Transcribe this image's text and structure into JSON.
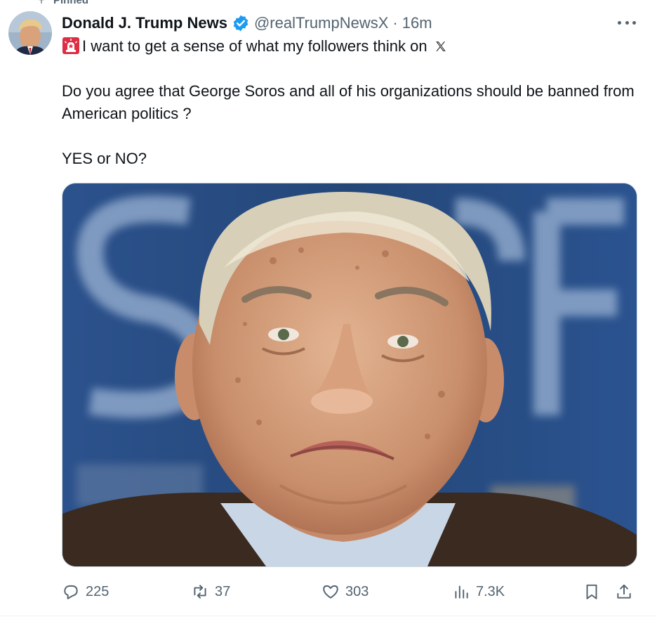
{
  "pinned_label": "Pinned",
  "author": {
    "name": "Donald J. Trump News",
    "handle": "@realTrumpNewsX",
    "separator": "·",
    "time": "16m",
    "verified": true,
    "avatar_icon": "avatar-photo"
  },
  "tweet": {
    "line1": "I want to get a sense of what my followers think on",
    "line1_emoji": "rotating-light-emoji",
    "line1_logo": "x-logo",
    "paragraph2": "Do you agree that George Soros and all of his organizations should be banned from American politics ?",
    "paragraph3": "YES or NO?"
  },
  "media": {
    "type": "photo",
    "description_icon": "photo-of-man"
  },
  "actions": {
    "replies": "225",
    "reposts": "37",
    "likes": "303",
    "views": "7.3K"
  },
  "colors": {
    "accent": "#1d9bf0",
    "text": "#0f1419",
    "muted": "#536471",
    "border": "#cfd9de"
  }
}
